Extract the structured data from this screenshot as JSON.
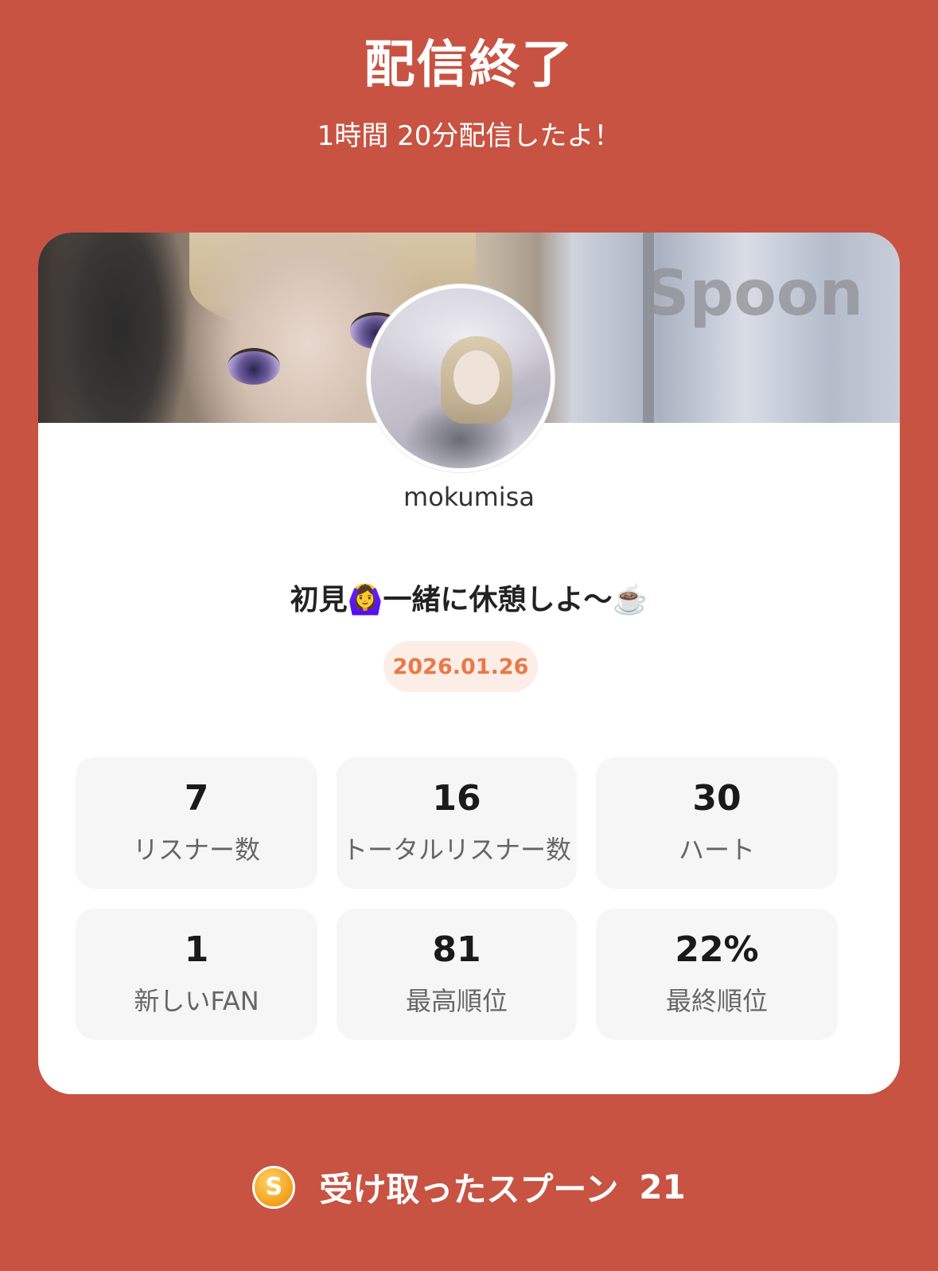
{
  "header": {
    "title": "配信終了",
    "subtitle": "1時間 20分配信したよ！"
  },
  "card": {
    "watermark": "Spoon",
    "username": "mokumisa",
    "stream_title": "初見🙆‍♀️一緒に休憩しよ〜☕️",
    "date": "2026.01.26",
    "stats": [
      {
        "value": "7",
        "label": "リスナー数"
      },
      {
        "value": "16",
        "label": "トータルリスナー数"
      },
      {
        "value": "30",
        "label": "ハート"
      },
      {
        "value": "1",
        "label": "新しいFAN"
      },
      {
        "value": "81",
        "label": "最高順位"
      },
      {
        "value": "22%",
        "label": "最終順位"
      }
    ]
  },
  "footer": {
    "icon": "spoon-coin-icon",
    "icon_letter": "S",
    "label": "受け取ったスプーン",
    "count": "21"
  },
  "colors": {
    "background": "#C85342",
    "date_text": "#EB7846",
    "date_pill": "#FCEEE6",
    "stat_card": "#F6F6F6"
  }
}
